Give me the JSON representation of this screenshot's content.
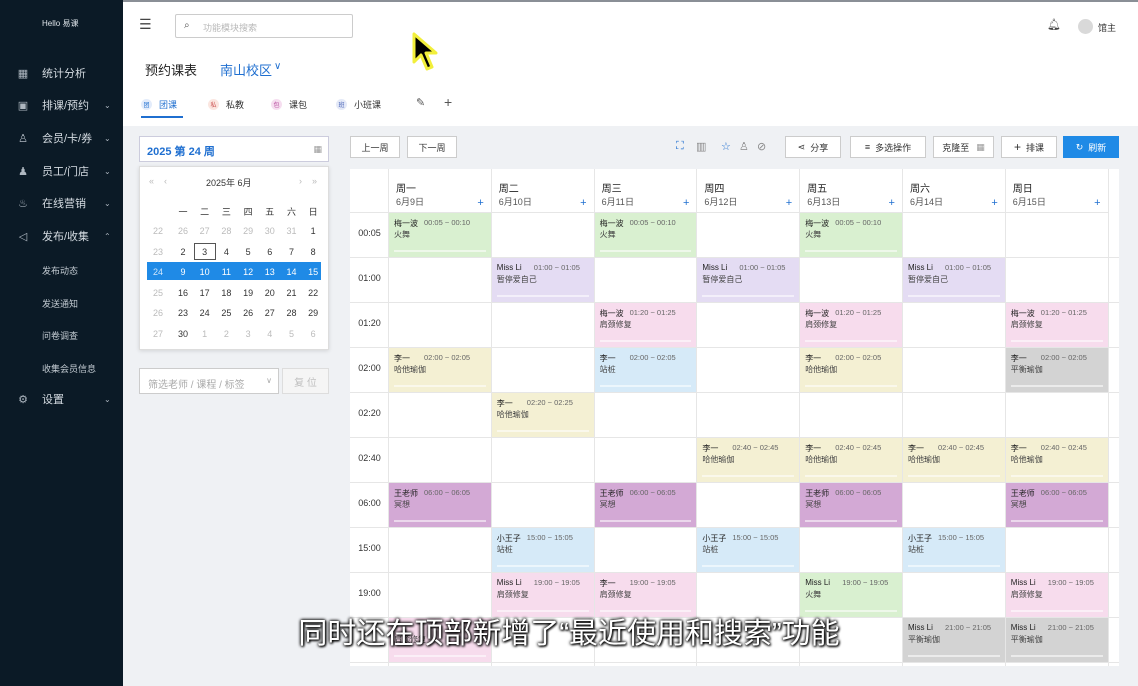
{
  "sidebar": {
    "brand": "Hello 易课",
    "items": [
      {
        "label": "统计分析",
        "icon": "chart-icon",
        "caret": ""
      },
      {
        "label": "排课/预约",
        "icon": "calendar-icon",
        "caret": "⌄"
      },
      {
        "label": "会员/卡/券",
        "icon": "user-icon",
        "caret": "⌄"
      },
      {
        "label": "员工/门店",
        "icon": "staff-icon",
        "caret": "⌄"
      },
      {
        "label": "在线营销",
        "icon": "flame-icon",
        "caret": "⌄"
      },
      {
        "label": "发布/收集",
        "icon": "megaphone-icon",
        "caret": "⌃"
      },
      {
        "label": "设置",
        "icon": "gear-icon",
        "caret": "⌄"
      }
    ],
    "subitems": [
      "发布动态",
      "发送通知",
      "问卷调查",
      "收集会员信息"
    ]
  },
  "topbar": {
    "search_placeholder": "功能模块搜索",
    "user": "馆主"
  },
  "page": {
    "title": "预约课表",
    "campus": "南山校区"
  },
  "tabs": [
    {
      "label": "团课",
      "icon": "团"
    },
    {
      "label": "私教",
      "icon": "私"
    },
    {
      "label": "课包",
      "icon": "包"
    },
    {
      "label": "小班课",
      "icon": "班"
    }
  ],
  "week_label": "2025 第 24 周",
  "calendar": {
    "year_month": "2025年  6月",
    "nav": [
      "«",
      "‹",
      "›",
      "»"
    ],
    "weekdays": [
      "一",
      "二",
      "三",
      "四",
      "五",
      "六",
      "日"
    ],
    "weeks": [
      [
        "26",
        "27",
        "28",
        "29",
        "30",
        "31",
        "1"
      ],
      [
        "2",
        "3",
        "4",
        "5",
        "6",
        "7",
        "8"
      ],
      [
        "9",
        "10",
        "11",
        "12",
        "13",
        "14",
        "15"
      ],
      [
        "16",
        "17",
        "18",
        "19",
        "20",
        "21",
        "22"
      ],
      [
        "23",
        "24",
        "25",
        "26",
        "27",
        "28",
        "29"
      ],
      [
        "30",
        "1",
        "2",
        "3",
        "4",
        "5",
        "6"
      ]
    ],
    "prefix": [
      "22",
      "23",
      "24",
      "25",
      "26",
      "27"
    ],
    "today": "3",
    "selected_week_index": 2
  },
  "filter": {
    "placeholder": "筛选老师 / 课程 / 标签",
    "reset": "复 位"
  },
  "toolbar": {
    "prev": "上一周",
    "next": "下一周",
    "share": "分享",
    "multi": "多选操作",
    "clone": "克隆至",
    "add": "排课",
    "refresh": "刷新"
  },
  "days": [
    {
      "name": "周一",
      "date": "6月9日"
    },
    {
      "name": "周二",
      "date": "6月10日"
    },
    {
      "name": "周三",
      "date": "6月11日"
    },
    {
      "name": "周四",
      "date": "6月12日"
    },
    {
      "name": "周五",
      "date": "6月13日"
    },
    {
      "name": "周六",
      "date": "6月14日"
    },
    {
      "name": "周日",
      "date": "6月15日"
    }
  ],
  "times": [
    "00:05",
    "01:00",
    "01:20",
    "02:00",
    "02:20",
    "02:40",
    "06:00",
    "15:00",
    "19:00",
    ""
  ],
  "events": [
    {
      "row": 0,
      "day": 0,
      "name": "梅一波",
      "time": "00:05 ~ 00:10",
      "course": "火舞",
      "color": "g"
    },
    {
      "row": 0,
      "day": 2,
      "name": "梅一波",
      "time": "00:05 ~ 00:10",
      "course": "火舞",
      "color": "g"
    },
    {
      "row": 0,
      "day": 4,
      "name": "梅一波",
      "time": "00:05 ~ 00:10",
      "course": "火舞",
      "color": "g"
    },
    {
      "row": 1,
      "day": 1,
      "name": "Miss Li",
      "time": "01:00 ~ 01:05",
      "course": "暂停爱自己",
      "color": "p"
    },
    {
      "row": 1,
      "day": 3,
      "name": "Miss Li",
      "time": "01:00 ~ 01:05",
      "course": "暂停爱自己",
      "color": "p"
    },
    {
      "row": 1,
      "day": 5,
      "name": "Miss Li",
      "time": "01:00 ~ 01:05",
      "course": "暂停爱自己",
      "color": "p"
    },
    {
      "row": 2,
      "day": 2,
      "name": "梅一波",
      "time": "01:20 ~ 01:25",
      "course": "肩颈修复",
      "color": "k"
    },
    {
      "row": 2,
      "day": 4,
      "name": "梅一波",
      "time": "01:20 ~ 01:25",
      "course": "肩颈修复",
      "color": "k"
    },
    {
      "row": 2,
      "day": 6,
      "name": "梅一波",
      "time": "01:20 ~ 01:25",
      "course": "肩颈修复",
      "color": "k"
    },
    {
      "row": 3,
      "day": 0,
      "name": "李一",
      "time": "02:00 ~ 02:05",
      "course": "哈他瑜伽",
      "color": "y"
    },
    {
      "row": 3,
      "day": 2,
      "name": "李一",
      "time": "02:00 ~ 02:05",
      "course": "站桩",
      "color": "b"
    },
    {
      "row": 3,
      "day": 4,
      "name": "李一",
      "time": "02:00 ~ 02:05",
      "course": "哈他瑜伽",
      "color": "y"
    },
    {
      "row": 3,
      "day": 6,
      "name": "李一",
      "time": "02:00 ~ 02:05",
      "course": "平衡瑜伽",
      "color": "gr"
    },
    {
      "row": 4,
      "day": 1,
      "name": "李一",
      "time": "02:20 ~ 02:25",
      "course": "哈他瑜伽",
      "color": "y"
    },
    {
      "row": 5,
      "day": 3,
      "name": "李一",
      "time": "02:40 ~ 02:45",
      "course": "哈他瑜伽",
      "color": "y"
    },
    {
      "row": 5,
      "day": 4,
      "name": "李一",
      "time": "02:40 ~ 02:45",
      "course": "哈他瑜伽",
      "color": "y"
    },
    {
      "row": 5,
      "day": 5,
      "name": "李一",
      "time": "02:40 ~ 02:45",
      "course": "哈他瑜伽",
      "color": "y"
    },
    {
      "row": 5,
      "day": 6,
      "name": "李一",
      "time": "02:40 ~ 02:45",
      "course": "哈他瑜伽",
      "color": "y"
    },
    {
      "row": 6,
      "day": 0,
      "name": "王老师",
      "time": "06:00 ~ 06:05",
      "course": "冥想",
      "color": "m"
    },
    {
      "row": 6,
      "day": 2,
      "name": "王老师",
      "time": "06:00 ~ 06:05",
      "course": "冥想",
      "color": "m"
    },
    {
      "row": 6,
      "day": 4,
      "name": "王老师",
      "time": "06:00 ~ 06:05",
      "course": "冥想",
      "color": "m"
    },
    {
      "row": 6,
      "day": 6,
      "name": "王老师",
      "time": "06:00 ~ 06:05",
      "course": "冥想",
      "color": "m"
    },
    {
      "row": 7,
      "day": 1,
      "name": "小王子",
      "time": "15:00 ~ 15:05",
      "course": "站桩",
      "color": "b"
    },
    {
      "row": 7,
      "day": 3,
      "name": "小王子",
      "time": "15:00 ~ 15:05",
      "course": "站桩",
      "color": "b"
    },
    {
      "row": 7,
      "day": 5,
      "name": "小王子",
      "time": "15:00 ~ 15:05",
      "course": "站桩",
      "color": "b"
    },
    {
      "row": 8,
      "day": 1,
      "name": "Miss Li",
      "time": "19:00 ~ 19:05",
      "course": "肩颈修复",
      "color": "k"
    },
    {
      "row": 8,
      "day": 2,
      "name": "李一",
      "time": "19:00 ~ 19:05",
      "course": "肩颈修复",
      "color": "k"
    },
    {
      "row": 8,
      "day": 4,
      "name": "Miss Li",
      "time": "19:00 ~ 19:05",
      "course": "火舞",
      "color": "g"
    },
    {
      "row": 8,
      "day": 6,
      "name": "Miss Li",
      "time": "19:00 ~ 19:05",
      "course": "肩颈修复",
      "color": "k"
    },
    {
      "row": 9,
      "day": 0,
      "name": "",
      "time": "",
      "course": "肩颈修复",
      "color": "k"
    },
    {
      "row": 9,
      "day": 5,
      "name": "Miss Li",
      "time": "21:00 ~ 21:05",
      "course": "平衡瑜伽",
      "color": "gr"
    },
    {
      "row": 9,
      "day": 6,
      "name": "Miss Li",
      "time": "21:00 ~ 21:05",
      "course": "平衡瑜伽",
      "color": "gr"
    }
  ],
  "subtitle": "同时还在顶部新增了“最近使用和搜索”功能",
  "colors": {
    "accent": "#1f6fd0",
    "sidebar": "#0b1a26",
    "selected_week": "#1f8ae6"
  }
}
